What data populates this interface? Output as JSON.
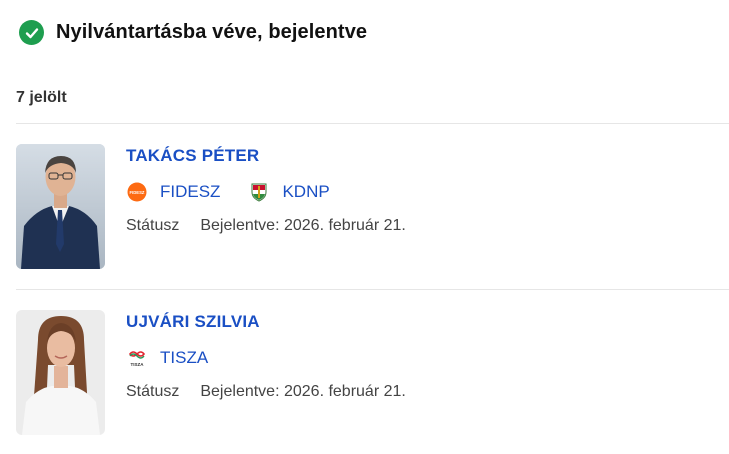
{
  "header": {
    "status_title": "Nyilvántartásba véve, bejelentve",
    "status_icon": "check-circle-icon",
    "status_color": "#1e9e4f"
  },
  "candidates_count": "7 jelölt",
  "accent_color": "#1a4fc4",
  "candidates": [
    {
      "name": "TAKÁCS PÉTER",
      "parties": [
        {
          "label": "FIDESZ",
          "icon": "fidesz-logo-icon"
        },
        {
          "label": "KDNP",
          "icon": "kdnp-logo-icon"
        }
      ],
      "status_label": "Státusz",
      "status_value": "Bejelentve: 2026. február 21."
    },
    {
      "name": "UJVÁRI SZILVIA",
      "parties": [
        {
          "label": "TISZA",
          "icon": "tisza-logo-icon"
        }
      ],
      "status_label": "Státusz",
      "status_value": "Bejelentve: 2026. február 21."
    }
  ]
}
